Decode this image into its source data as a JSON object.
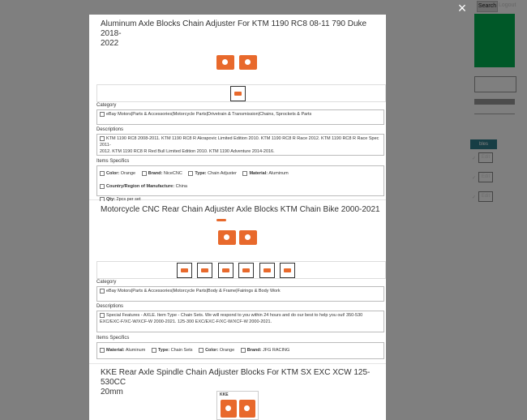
{
  "header": {
    "search_label": "Search",
    "logout_label": "Logout"
  },
  "background": {
    "tab_label": "bles",
    "edit_label": "Edit"
  },
  "modal": {
    "close_label": "×",
    "products": [
      {
        "title_line1": "Aluminum Axle Blocks Chain Adjuster For KTM 1190 RC8 08-11 790 Duke 2018-",
        "title_line2": "2022",
        "category_label": "Category",
        "category": "eBay Motors|Parts & Accessories|Motorcycle Parts|Drivetrain & Transmission|Chains, Sprockets & Parts",
        "descriptions_label": "Descriptions",
        "description_line1": "KTM 1190 RC8 2008-2011. KTM 1190 RC8 R Akrapovic Limited Edition 2010. KTM 1190 RC8 R Race 2012. KTM 1190 RC8 R Race Spec 2011-",
        "description_line2": "2012. KTM 1190 RC8 R Red Bull Limited Edition 2010. KTM 1190 Adventure 2014-2016.",
        "specifics_label": "Items Specifics",
        "specifics": [
          {
            "key": "Color:",
            "value": "Orange"
          },
          {
            "key": "Brand:",
            "value": "NiceCNC"
          },
          {
            "key": "Type:",
            "value": "Chain Adjuster"
          },
          {
            "key": "Material:",
            "value": "Aluminum"
          },
          {
            "key": "Country/Region of Manufacture:",
            "value": "China"
          },
          {
            "key": "Qty:",
            "value": "2pcs per set"
          }
        ]
      },
      {
        "title_line1": "Motorcycle CNC Rear Chain Adjuster Axle Blocks KTM Chain Bike 2000-2021",
        "category_label": "Category",
        "category": "eBay Motors|Parts & Accessories|Motorcycle Parts|Body & Frame|Fairings & Body Work",
        "descriptions_label": "Descriptions",
        "description_line1": "Special Features - AXLE. Item Type - Chain Sets. We will respond to you within 24 hours and do our best to help you out! 350-530",
        "description_line2": "EXC/EXC-F/XC-W/XCF-W 2000-2021. 125-300 EXC/EXC-F/XC-W/XCF-W 2000-2021.",
        "specifics_label": "Items Specifics",
        "specifics": [
          {
            "key": "Material:",
            "value": "Aluminum"
          },
          {
            "key": "Type:",
            "value": "Chain Sets"
          },
          {
            "key": "Color:",
            "value": "Orange"
          },
          {
            "key": "Brand:",
            "value": "JFG RACING"
          }
        ]
      },
      {
        "title_line1": "KKE Rear Axle Spindle Chain Adjuster Blocks For KTM SX EXC XCW 125-530CC",
        "title_line2": "20mm",
        "logo_text": "KKE"
      }
    ]
  },
  "colors": {
    "accent_orange": "#e8692c",
    "green_panel": "#00b050",
    "teal_tab": "#2e7d8a"
  }
}
